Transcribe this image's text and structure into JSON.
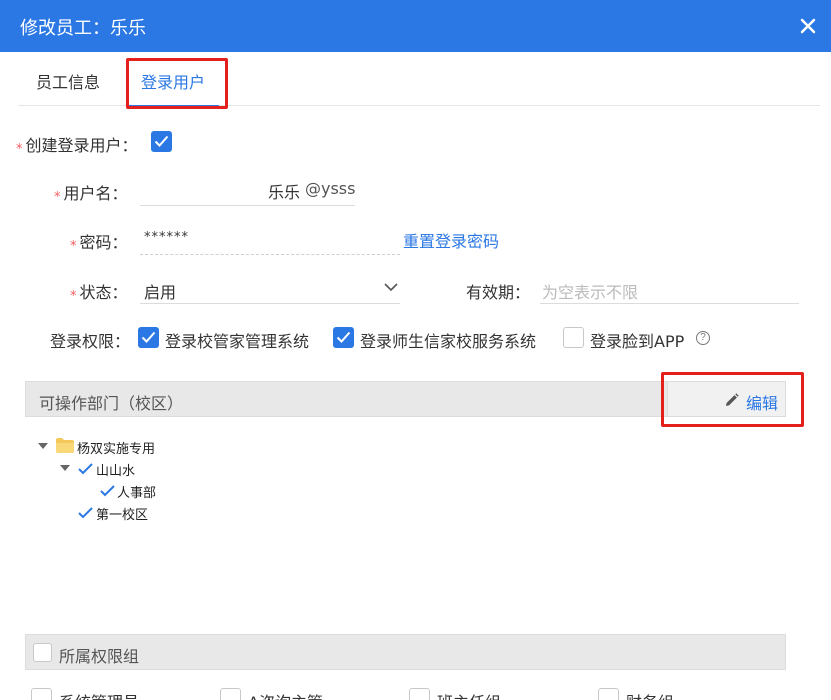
{
  "dialog": {
    "title": "修改员工：乐乐"
  },
  "tabs": [
    {
      "label": "员工信息",
      "active": false
    },
    {
      "label": "登录用户",
      "active": true
    }
  ],
  "form": {
    "create_login": {
      "label": "创建登录用户：",
      "checked": true
    },
    "username": {
      "label": "用户名：",
      "value": "乐乐",
      "suffix": "@ysss"
    },
    "password": {
      "label": "密码：",
      "value": "******",
      "reset_link": "重置登录密码"
    },
    "status": {
      "label": "状态：",
      "value": "启用"
    },
    "validity": {
      "label": "有效期：",
      "placeholder": "为空表示不限"
    },
    "permissions": {
      "label": "登录权限：",
      "options": [
        {
          "label": "登录校管家管理系统",
          "checked": true
        },
        {
          "label": "登录师生信家校服务系统",
          "checked": true
        },
        {
          "label": "登录脸到APP",
          "checked": false
        }
      ],
      "help_glyph": "?"
    }
  },
  "departments": {
    "title": "可操作部门（校区）",
    "edit_label": "编辑",
    "tree": {
      "root": "杨双实施专用",
      "child": "山山水",
      "grandchild": "人事部",
      "sibling": "第一校区"
    }
  },
  "groups": {
    "title": "所属权限组",
    "items": [
      "系统管理员",
      "A咨询主管",
      "班主任组",
      "财务组"
    ]
  },
  "colors": {
    "accent": "#2b78e4",
    "highlight": "#e3201c",
    "required": "#f25c5c"
  }
}
